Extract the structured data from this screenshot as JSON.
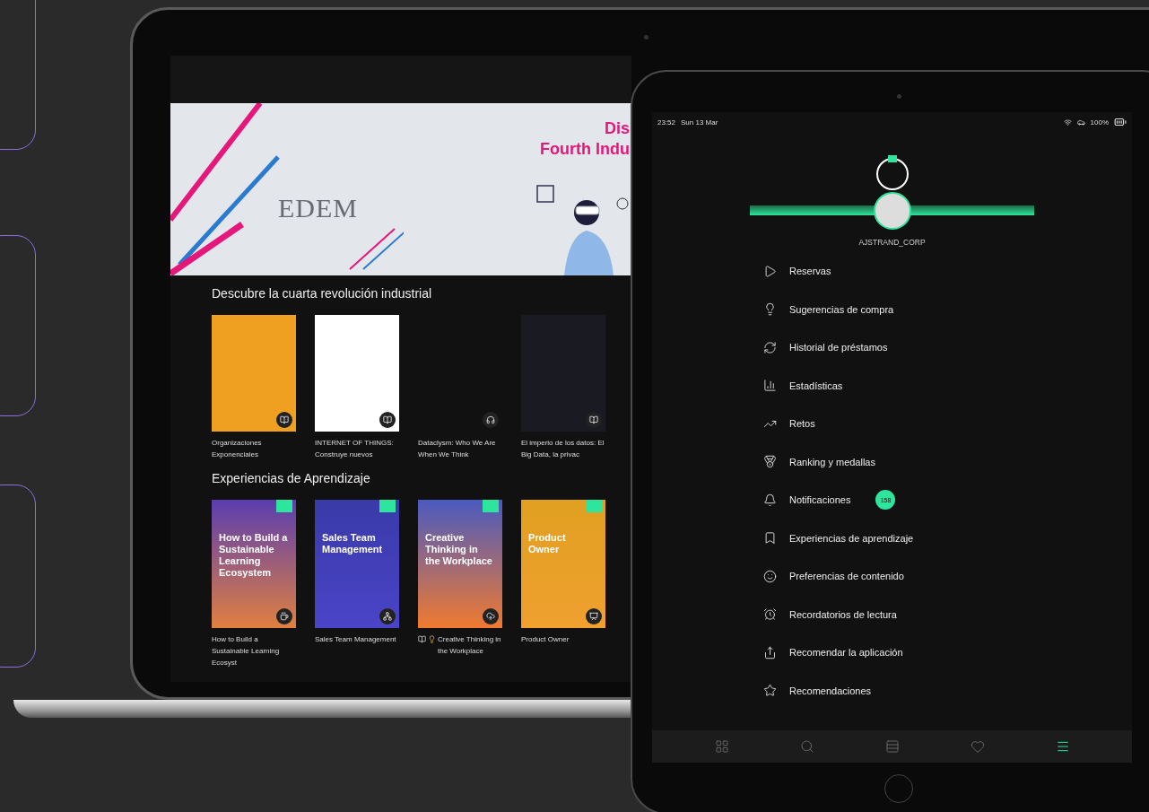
{
  "laptop": {
    "banner": {
      "logo": "EDEM",
      "title_line_1": "Dis",
      "title_line_2": "Fourth Indu"
    },
    "sections": [
      {
        "title": "Descubre la cuarta revolución industrial",
        "kind": "books",
        "items": [
          {
            "title": "Organizaciones Exponenciales",
            "kind": "ebook"
          },
          {
            "title": "INTERNET OF THINGS: Construye nuevos",
            "kind": "ebook"
          },
          {
            "title": "Dataclysm: Who We Are When We Think",
            "kind": "audiobook"
          },
          {
            "title": "El imperio de los datos: El Big Data, la privac",
            "kind": "ebook"
          }
        ]
      },
      {
        "title": "Experiencias de Aprendizaje",
        "kind": "experiences",
        "items": [
          {
            "cover_title": "How to Build a Sustainable Learning Ecosystem",
            "title": "How to Build a Sustainable Learning Ecosyst"
          },
          {
            "cover_title": "Sales Team Management",
            "title": "Sales Team Management"
          },
          {
            "cover_title": "Creative Thinking in the Workplace",
            "title": "Creative Thinking in the Workplace"
          },
          {
            "cover_title": "Product Owner",
            "title": "Product Owner"
          }
        ]
      }
    ]
  },
  "tablet": {
    "status_bar": {
      "time": "23:52",
      "date": "Sun 13 Mar",
      "battery": "100%"
    },
    "username": "AJSTRAND_CORP",
    "menu": [
      {
        "label": "Reservas"
      },
      {
        "label": "Sugerencias de compra"
      },
      {
        "label": "Historial de préstamos"
      },
      {
        "label": "Estadísticas"
      },
      {
        "label": "Retos"
      },
      {
        "label": "Ranking y medallas"
      },
      {
        "label": "Notificaciones",
        "badge": "158"
      },
      {
        "label": "Experiencias de aprendizaje"
      },
      {
        "label": "Preferencias de contenido"
      },
      {
        "label": "Recordatorios de lectura"
      },
      {
        "label": "Recomendar la aplicación"
      },
      {
        "label": "Recomendaciones"
      }
    ],
    "tabs": [
      {
        "selected": false
      },
      {
        "selected": false
      },
      {
        "selected": false
      },
      {
        "selected": false
      },
      {
        "selected": true
      }
    ]
  }
}
